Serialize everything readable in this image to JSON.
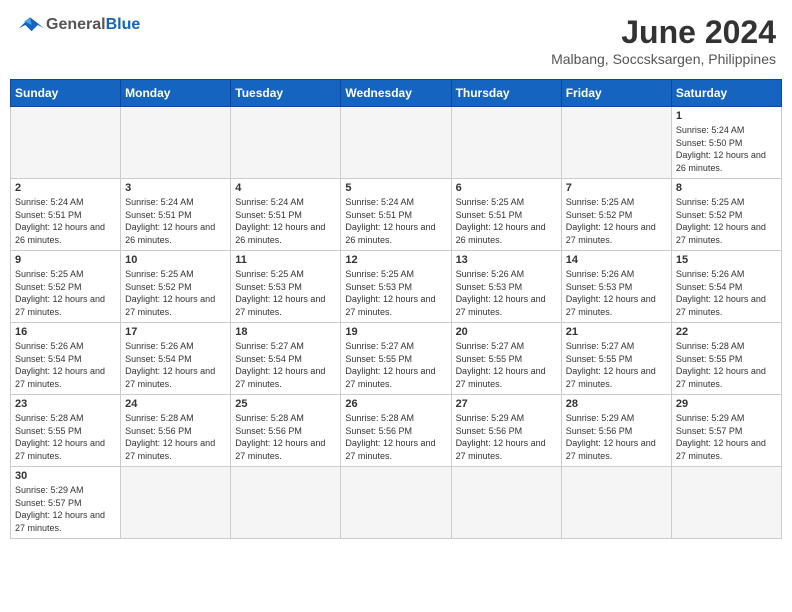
{
  "header": {
    "logo_general": "General",
    "logo_blue": "Blue",
    "month_title": "June 2024",
    "location": "Malbang, Soccsksargen, Philippines"
  },
  "days_of_week": [
    "Sunday",
    "Monday",
    "Tuesday",
    "Wednesday",
    "Thursday",
    "Friday",
    "Saturday"
  ],
  "weeks": [
    [
      {
        "day": "",
        "info": "",
        "empty": true
      },
      {
        "day": "",
        "info": "",
        "empty": true
      },
      {
        "day": "",
        "info": "",
        "empty": true
      },
      {
        "day": "",
        "info": "",
        "empty": true
      },
      {
        "day": "",
        "info": "",
        "empty": true
      },
      {
        "day": "",
        "info": "",
        "empty": true
      },
      {
        "day": "1",
        "info": "Sunrise: 5:24 AM\nSunset: 5:50 PM\nDaylight: 12 hours and 26 minutes.",
        "empty": false
      }
    ],
    [
      {
        "day": "2",
        "info": "Sunrise: 5:24 AM\nSunset: 5:51 PM\nDaylight: 12 hours and 26 minutes.",
        "empty": false
      },
      {
        "day": "3",
        "info": "Sunrise: 5:24 AM\nSunset: 5:51 PM\nDaylight: 12 hours and 26 minutes.",
        "empty": false
      },
      {
        "day": "4",
        "info": "Sunrise: 5:24 AM\nSunset: 5:51 PM\nDaylight: 12 hours and 26 minutes.",
        "empty": false
      },
      {
        "day": "5",
        "info": "Sunrise: 5:24 AM\nSunset: 5:51 PM\nDaylight: 12 hours and 26 minutes.",
        "empty": false
      },
      {
        "day": "6",
        "info": "Sunrise: 5:25 AM\nSunset: 5:51 PM\nDaylight: 12 hours and 26 minutes.",
        "empty": false
      },
      {
        "day": "7",
        "info": "Sunrise: 5:25 AM\nSunset: 5:52 PM\nDaylight: 12 hours and 27 minutes.",
        "empty": false
      },
      {
        "day": "8",
        "info": "Sunrise: 5:25 AM\nSunset: 5:52 PM\nDaylight: 12 hours and 27 minutes.",
        "empty": false
      }
    ],
    [
      {
        "day": "9",
        "info": "Sunrise: 5:25 AM\nSunset: 5:52 PM\nDaylight: 12 hours and 27 minutes.",
        "empty": false
      },
      {
        "day": "10",
        "info": "Sunrise: 5:25 AM\nSunset: 5:52 PM\nDaylight: 12 hours and 27 minutes.",
        "empty": false
      },
      {
        "day": "11",
        "info": "Sunrise: 5:25 AM\nSunset: 5:53 PM\nDaylight: 12 hours and 27 minutes.",
        "empty": false
      },
      {
        "day": "12",
        "info": "Sunrise: 5:25 AM\nSunset: 5:53 PM\nDaylight: 12 hours and 27 minutes.",
        "empty": false
      },
      {
        "day": "13",
        "info": "Sunrise: 5:26 AM\nSunset: 5:53 PM\nDaylight: 12 hours and 27 minutes.",
        "empty": false
      },
      {
        "day": "14",
        "info": "Sunrise: 5:26 AM\nSunset: 5:53 PM\nDaylight: 12 hours and 27 minutes.",
        "empty": false
      },
      {
        "day": "15",
        "info": "Sunrise: 5:26 AM\nSunset: 5:54 PM\nDaylight: 12 hours and 27 minutes.",
        "empty": false
      }
    ],
    [
      {
        "day": "16",
        "info": "Sunrise: 5:26 AM\nSunset: 5:54 PM\nDaylight: 12 hours and 27 minutes.",
        "empty": false
      },
      {
        "day": "17",
        "info": "Sunrise: 5:26 AM\nSunset: 5:54 PM\nDaylight: 12 hours and 27 minutes.",
        "empty": false
      },
      {
        "day": "18",
        "info": "Sunrise: 5:27 AM\nSunset: 5:54 PM\nDaylight: 12 hours and 27 minutes.",
        "empty": false
      },
      {
        "day": "19",
        "info": "Sunrise: 5:27 AM\nSunset: 5:55 PM\nDaylight: 12 hours and 27 minutes.",
        "empty": false
      },
      {
        "day": "20",
        "info": "Sunrise: 5:27 AM\nSunset: 5:55 PM\nDaylight: 12 hours and 27 minutes.",
        "empty": false
      },
      {
        "day": "21",
        "info": "Sunrise: 5:27 AM\nSunset: 5:55 PM\nDaylight: 12 hours and 27 minutes.",
        "empty": false
      },
      {
        "day": "22",
        "info": "Sunrise: 5:28 AM\nSunset: 5:55 PM\nDaylight: 12 hours and 27 minutes.",
        "empty": false
      }
    ],
    [
      {
        "day": "23",
        "info": "Sunrise: 5:28 AM\nSunset: 5:55 PM\nDaylight: 12 hours and 27 minutes.",
        "empty": false
      },
      {
        "day": "24",
        "info": "Sunrise: 5:28 AM\nSunset: 5:56 PM\nDaylight: 12 hours and 27 minutes.",
        "empty": false
      },
      {
        "day": "25",
        "info": "Sunrise: 5:28 AM\nSunset: 5:56 PM\nDaylight: 12 hours and 27 minutes.",
        "empty": false
      },
      {
        "day": "26",
        "info": "Sunrise: 5:28 AM\nSunset: 5:56 PM\nDaylight: 12 hours and 27 minutes.",
        "empty": false
      },
      {
        "day": "27",
        "info": "Sunrise: 5:29 AM\nSunset: 5:56 PM\nDaylight: 12 hours and 27 minutes.",
        "empty": false
      },
      {
        "day": "28",
        "info": "Sunrise: 5:29 AM\nSunset: 5:56 PM\nDaylight: 12 hours and 27 minutes.",
        "empty": false
      },
      {
        "day": "29",
        "info": "Sunrise: 5:29 AM\nSunset: 5:57 PM\nDaylight: 12 hours and 27 minutes.",
        "empty": false
      }
    ],
    [
      {
        "day": "30",
        "info": "Sunrise: 5:29 AM\nSunset: 5:57 PM\nDaylight: 12 hours and 27 minutes.",
        "empty": false
      },
      {
        "day": "",
        "info": "",
        "empty": true
      },
      {
        "day": "",
        "info": "",
        "empty": true
      },
      {
        "day": "",
        "info": "",
        "empty": true
      },
      {
        "day": "",
        "info": "",
        "empty": true
      },
      {
        "day": "",
        "info": "",
        "empty": true
      },
      {
        "day": "",
        "info": "",
        "empty": true
      }
    ]
  ]
}
